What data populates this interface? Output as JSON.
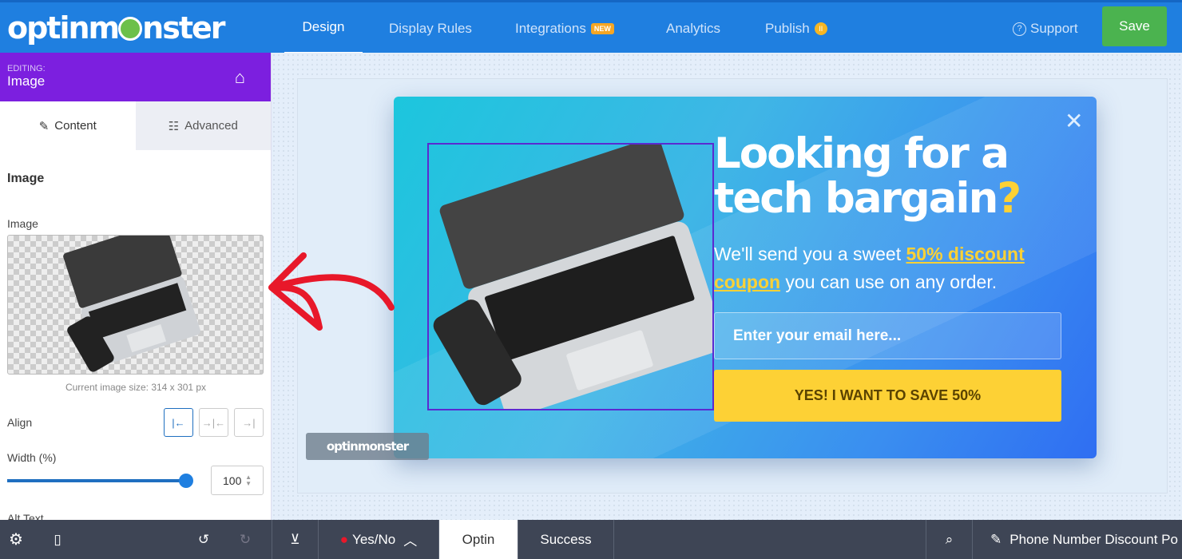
{
  "header": {
    "logo": "optinmonster",
    "nav": [
      {
        "label": "Design"
      },
      {
        "label": "Display Rules"
      },
      {
        "label": "Integrations",
        "badge": "NEW"
      },
      {
        "label": "Analytics"
      },
      {
        "label": "Publish"
      }
    ],
    "support": "Support",
    "save": "Save"
  },
  "sidebar": {
    "editing_label": "EDITING:",
    "editing_value": "Image",
    "tabs": [
      {
        "label": "Content"
      },
      {
        "label": "Advanced"
      }
    ],
    "section_title": "Image",
    "image_label": "Image",
    "image_size": "Current image size: 314 x 301 px",
    "align_label": "Align",
    "width_label": "Width (%)",
    "width_value": "100",
    "width_percent": 100,
    "alt_label": "Alt Text"
  },
  "popup": {
    "headline_a": "Looking for a tech bargain",
    "headline_q": "?",
    "sub_a": "We'll send you a sweet ",
    "sub_link": "50% discount coupon",
    "sub_b": " you can use on any order.",
    "email_placeholder": "Enter your email here...",
    "cta": "YES! I WANT TO SAVE 50%",
    "watermark": "optinmonster"
  },
  "bottom": {
    "view": "Yes/No",
    "tabs": [
      "Optin",
      "Success"
    ],
    "campaign": "Phone Number Discount Po"
  },
  "colors": {
    "topbar": "#1f7fe0",
    "editing": "#7c1fdf",
    "save": "#4bb34f",
    "cta": "#fdd135",
    "bottom": "#3e4555",
    "arrow": "#e8182a"
  }
}
